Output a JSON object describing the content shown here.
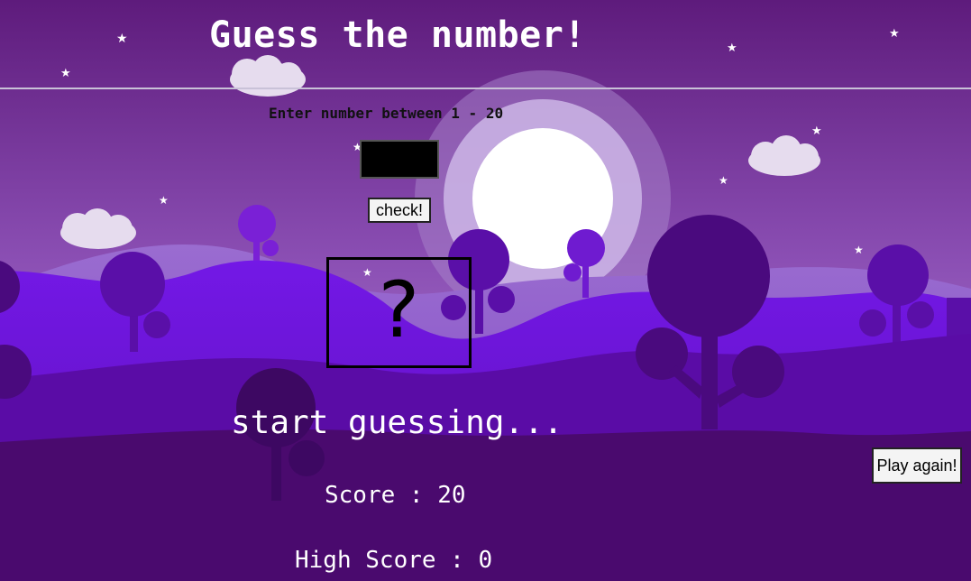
{
  "game": {
    "title": "Guess the number!",
    "prompt": "Enter number between 1 - 20",
    "guess_value": "",
    "check_label": "check!",
    "secret_display": "?",
    "message": "start guessing...",
    "score_label": "Score :",
    "score_value": "20",
    "high_score_label": "High Score :",
    "high_score_value": "0",
    "play_again_label": "Play again!"
  },
  "background": {
    "scene": "purple hills at night with full moon, clouds, stars and round trees",
    "colors": {
      "sky_top": "#5e1d7e",
      "sky_bottom": "#b48cd4",
      "moon": "#ffffff",
      "hill_front": "#4a0a6e",
      "hill_mid": "#6a18c8",
      "tree_dark": "#4a0d78"
    }
  }
}
